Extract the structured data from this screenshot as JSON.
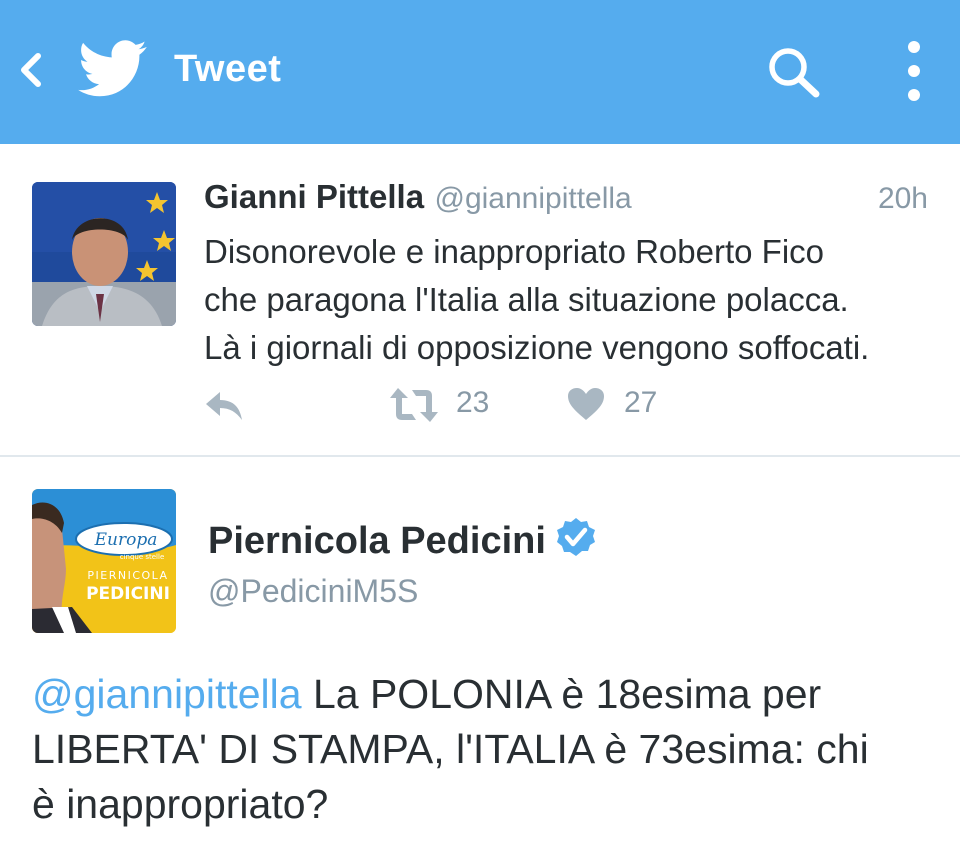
{
  "topbar": {
    "title": "Tweet",
    "back_icon": "chevron-left-icon",
    "logo_icon": "twitter-bird-icon",
    "search_icon": "search-icon",
    "more_icon": "more-vertical-icon",
    "background_color": "#55acee"
  },
  "tweets": [
    {
      "author_name": "Gianni Pittella",
      "handle": "@giannipittella",
      "time": "20h",
      "text_lines": [
        "Disonorevole e inappropriato Roberto Fico",
        "che paragona l'Italia alla situazione polacca.",
        "Là i giornali di opposizione vengono soffocati."
      ],
      "retweet_count": "23",
      "like_count": "27"
    },
    {
      "author_name": "Piernicola Pedicini",
      "handle": "@PediciniM5S",
      "verified": true,
      "avatar_text": {
        "logo_word": "Europa",
        "logo_subword": "cinque stelle",
        "first_name": "PIERNICOLA",
        "last_name": "PEDICINI"
      },
      "mention": "@giannipittella",
      "text_lines": [
        " La POLONIA è 18esima per",
        "LIBERTA' DI STAMPA, l'ITALIA è 73esima: chi",
        "è inappropriato?"
      ]
    }
  ],
  "colors": {
    "accent": "#55acee",
    "text_primary": "#292f33",
    "text_secondary": "#8899a6",
    "divider": "#e1e8ed"
  }
}
